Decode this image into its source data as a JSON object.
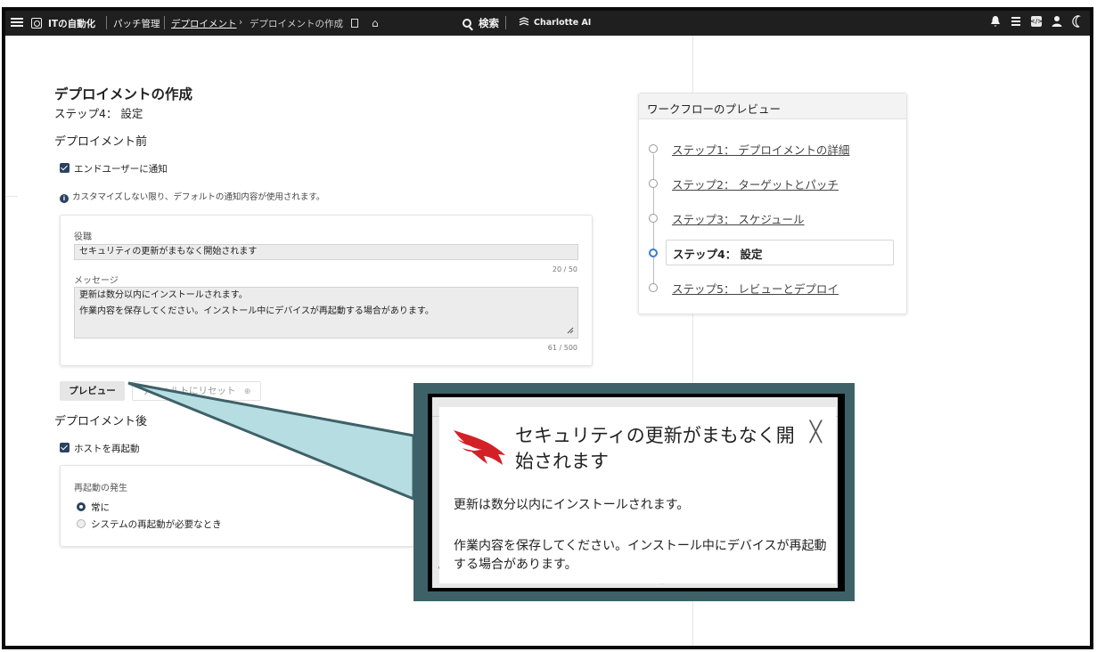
{
  "topbar": {
    "app_name": "ITの自動化",
    "crumb_patch": "パッチ管理",
    "crumb_deploy": "デプロイメント",
    "crumb_arrow": "›",
    "crumb_create": "デプロイメントの作成",
    "search_label": "検索",
    "charlotte_label": "Charlotte AI",
    "icons": [
      "menu-icon",
      "app-icon",
      "bookmark-icon",
      "home-icon",
      "search-icon",
      "charlotte-icon",
      "bell-icon",
      "inbox-icon",
      "code-icon",
      "user-icon",
      "moon-icon"
    ]
  },
  "page": {
    "title": "デプロイメントの作成",
    "step": "ステップ4： 設定"
  },
  "pre": {
    "heading": "デプロイメント前",
    "notify_label": "エンドユーザーに通知",
    "info_text": "カスタマイズしない限り、デフォルトの通知内容が使用されます。",
    "title_label": "役職",
    "title_value": "セキュリティの更新がまもなく開始されます",
    "title_count": "20 / 50",
    "message_label": "メッセージ",
    "message_line1": "更新は数分以内にインストールされます。",
    "message_line2": "作業内容を保存してください。インストール中にデバイスが再起動する場合があります。",
    "message_count": "61 / 500",
    "preview_button": "プレビュー",
    "reset_button": "デフォルトにリセット",
    "reset_icon": "lock-icon"
  },
  "post": {
    "heading": "デプロイメント後",
    "restart_label": "ホストを再起動",
    "when_label": "再起動の発生",
    "option_always": "常に",
    "option_required": "システムの再起動が必要なとき"
  },
  "workflow": {
    "heading": "ワークフローのプレビュー",
    "steps": [
      "ステップ1： デプロイメントの詳細",
      "ステップ2： ターゲットとパッチ",
      "ステップ3： スケジュール",
      "ステップ4： 設定",
      "ステップ5： レビューとデプロイ"
    ],
    "active_index": 3
  },
  "preview_popup": {
    "title": "セキュリティの更新がまもなく開始されます",
    "body_line1": "更新は数分以内にインストールされます。",
    "body_line2": "作業内容を保存してください。インストール中にデバイスが再起動する場合があります。",
    "close_icon": "close-icon",
    "logo": "falcon-logo",
    "bg_fragment_char": "あ",
    "bg_fragment_count": "61 / 500"
  },
  "colors": {
    "topbar": "#1f1f1f",
    "accent": "#2a4260",
    "active_step": "#3b7bd0",
    "callout": "#3e6168",
    "callout_light": "#b6dde2",
    "falcon_red": "#d32027"
  }
}
